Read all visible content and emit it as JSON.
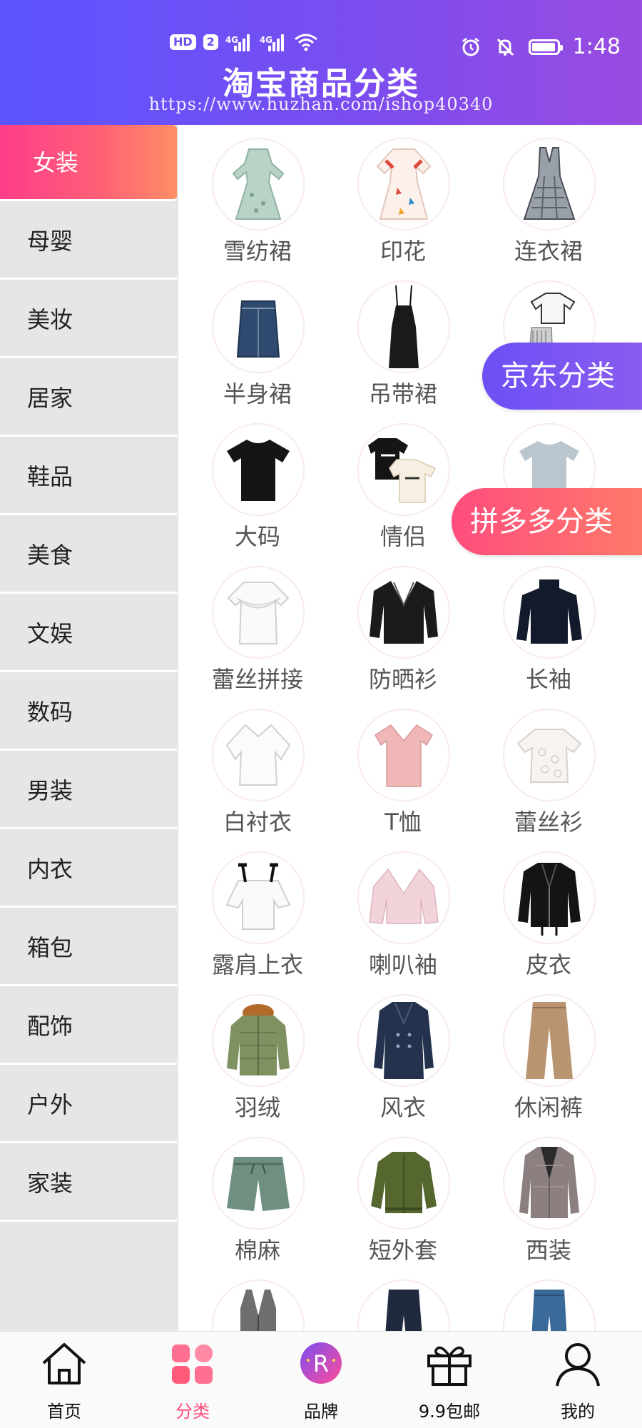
{
  "status_bar": {
    "hd": "HD",
    "sim": "2",
    "net1": "4G",
    "net2": "4G",
    "time": "1:48"
  },
  "header": {
    "title": "淘宝商品分类",
    "watermark": "https://www.huzhan.com/ishop40340"
  },
  "sidebar": {
    "items": [
      {
        "label": "女装",
        "active": true
      },
      {
        "label": "母婴"
      },
      {
        "label": "美妆"
      },
      {
        "label": "居家"
      },
      {
        "label": "鞋品"
      },
      {
        "label": "美食"
      },
      {
        "label": "文娱"
      },
      {
        "label": "数码"
      },
      {
        "label": "男装"
      },
      {
        "label": "内衣"
      },
      {
        "label": "箱包"
      },
      {
        "label": "配饰"
      },
      {
        "label": "户外"
      },
      {
        "label": "家装"
      }
    ]
  },
  "grid": {
    "items": [
      {
        "label": "雪纺裙",
        "icon": "chiffon-dress-icon"
      },
      {
        "label": "印花",
        "icon": "print-dress-icon"
      },
      {
        "label": "连衣裙",
        "icon": "dress-icon"
      },
      {
        "label": "半身裙",
        "icon": "skirt-icon"
      },
      {
        "label": "吊带裙",
        "icon": "slip-dress-icon"
      },
      {
        "label": "",
        "icon": "outfit-icon"
      },
      {
        "label": "大码",
        "icon": "tshirt-icon"
      },
      {
        "label": "情侣",
        "icon": "couple-tee-icon"
      },
      {
        "label": "",
        "icon": "tee-icon"
      },
      {
        "label": "蕾丝拼接",
        "icon": "lace-top-icon"
      },
      {
        "label": "防晒衫",
        "icon": "sun-shirt-icon"
      },
      {
        "label": "长袖",
        "icon": "long-sleeve-icon"
      },
      {
        "label": "白衬衣",
        "icon": "white-shirt-icon"
      },
      {
        "label": "T恤",
        "icon": "t-shirt-icon"
      },
      {
        "label": "蕾丝衫",
        "icon": "lace-shirt-icon"
      },
      {
        "label": "露肩上衣",
        "icon": "off-shoulder-icon"
      },
      {
        "label": "喇叭袖",
        "icon": "flare-sleeve-icon"
      },
      {
        "label": "皮衣",
        "icon": "leather-jacket-icon"
      },
      {
        "label": "羽绒",
        "icon": "down-coat-icon"
      },
      {
        "label": "风衣",
        "icon": "trench-coat-icon"
      },
      {
        "label": "休闲裤",
        "icon": "pants-icon"
      },
      {
        "label": "棉麻",
        "icon": "shorts-icon"
      },
      {
        "label": "短外套",
        "icon": "bomber-icon"
      },
      {
        "label": "西装",
        "icon": "blazer-icon"
      },
      {
        "label": "",
        "icon": "vest-icon"
      },
      {
        "label": "",
        "icon": "trousers-icon"
      },
      {
        "label": "",
        "icon": "jeans-icon"
      }
    ]
  },
  "floating": {
    "jd_label": "京东分类",
    "pdd_label": "拼多多分类"
  },
  "tabbar": {
    "items": [
      {
        "label": "首页",
        "icon": "home-icon"
      },
      {
        "label": "分类",
        "icon": "category-icon",
        "active": true
      },
      {
        "label": "品牌",
        "icon": "brand-icon"
      },
      {
        "label": "9.9包邮",
        "icon": "gift-icon"
      },
      {
        "label": "我的",
        "icon": "user-icon"
      }
    ]
  },
  "colors": {
    "header_start": "#5b54ff",
    "header_end": "#9a4be0",
    "accent_pink": "#ff4d7d",
    "jd_purple": "#6d4ff5",
    "sidebar_bg": "#e6e6e6"
  }
}
